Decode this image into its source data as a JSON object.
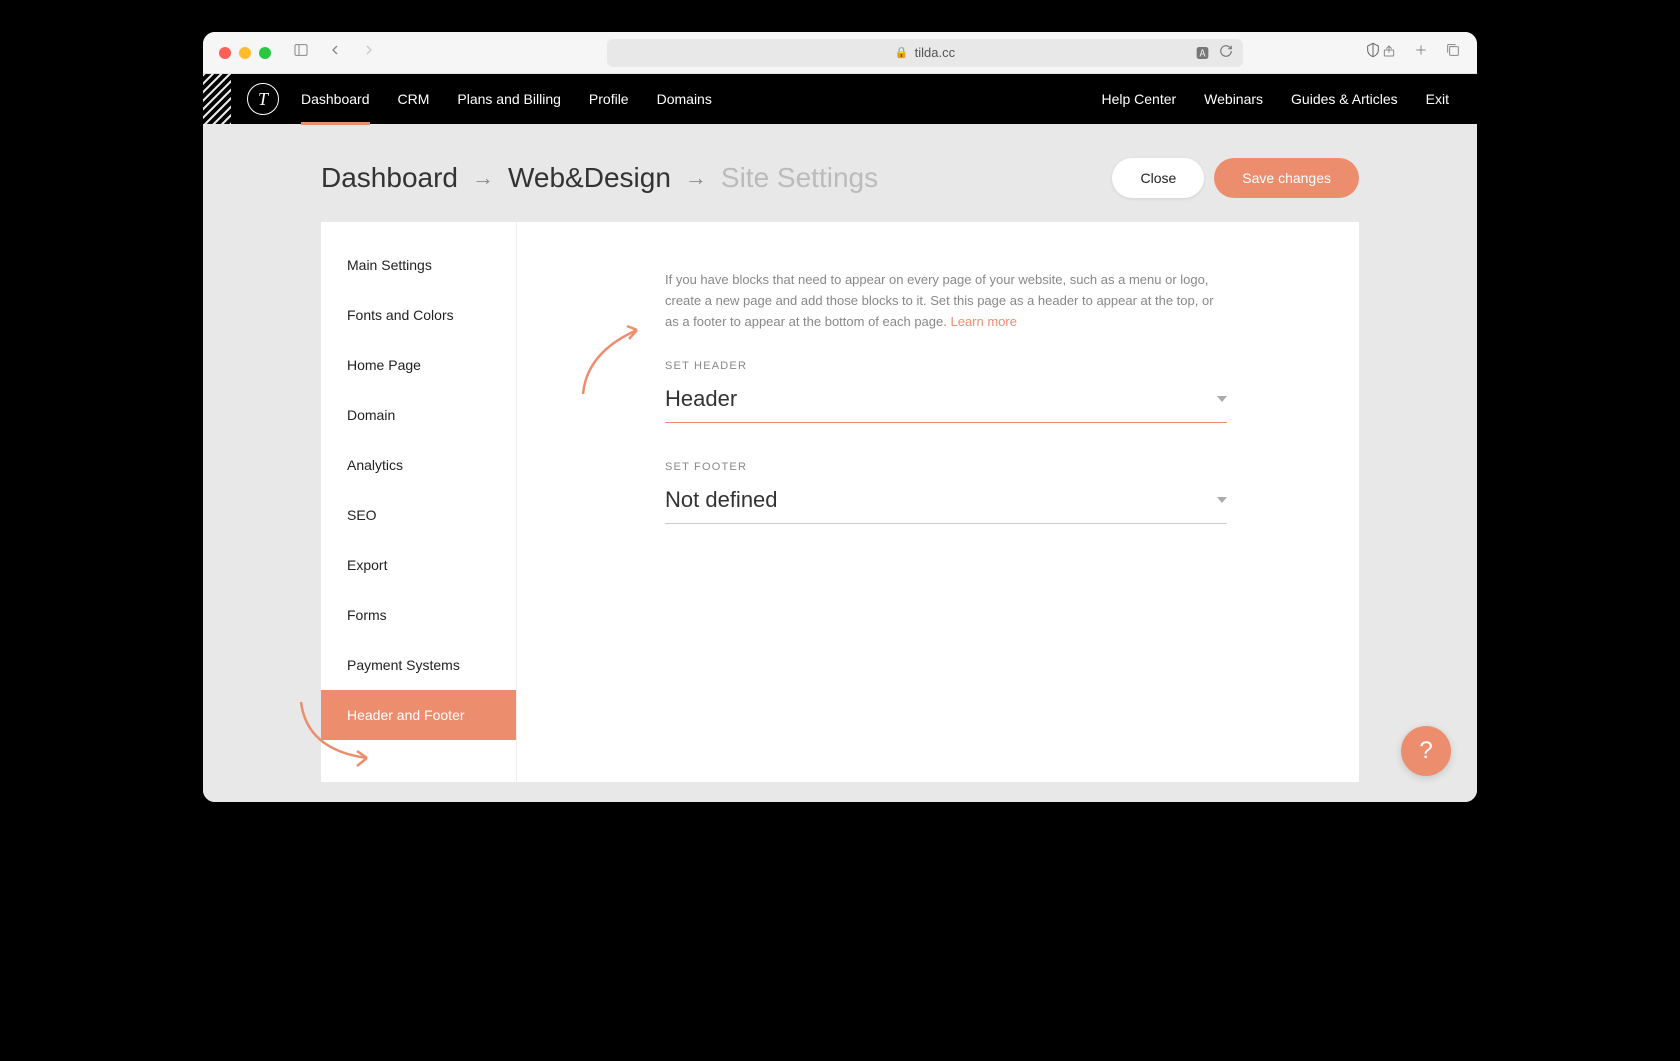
{
  "browser": {
    "url": "tilda.cc"
  },
  "nav": {
    "left": [
      "Dashboard",
      "CRM",
      "Plans and Billing",
      "Profile",
      "Domains"
    ],
    "right": [
      "Help Center",
      "Webinars",
      "Guides & Articles",
      "Exit"
    ],
    "active_index": 0
  },
  "breadcrumbs": {
    "part1": "Dashboard",
    "part2": "Web&Design",
    "part3": "Site Settings"
  },
  "actions": {
    "close": "Close",
    "save": "Save changes"
  },
  "sidebar": {
    "items": [
      "Main Settings",
      "Fonts and Colors",
      "Home Page",
      "Domain",
      "Analytics",
      "SEO",
      "Export",
      "Forms",
      "Payment Systems",
      "Header and Footer"
    ],
    "active_index": 9
  },
  "content": {
    "description": "If you have blocks that need to appear on every page of your website, such as a menu or logo, create a new page and add those blocks to it. Set this page as a header to appear at the top, or as a footer to appear at the bottom of each page. ",
    "learn_more": "Learn more",
    "header_label": "SET HEADER",
    "header_value": "Header",
    "footer_label": "SET FOOTER",
    "footer_value": "Not defined"
  },
  "help_fab": "?"
}
